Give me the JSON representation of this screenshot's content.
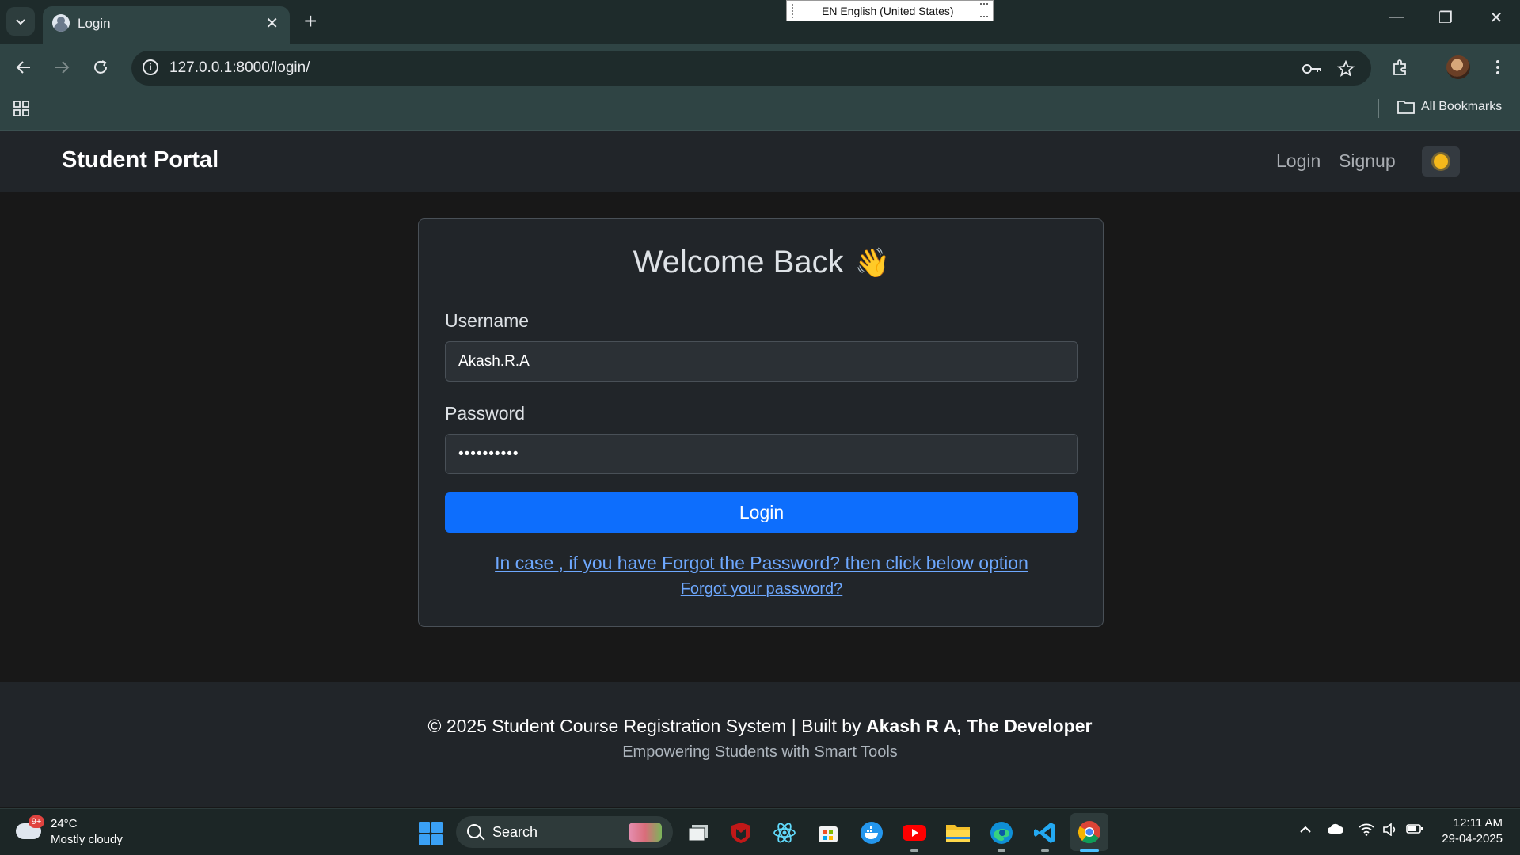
{
  "browser": {
    "tab_title": "Login",
    "url": "127.0.0.1:8000/login/",
    "language_indicator": "EN English (United States)",
    "all_bookmarks_label": "All Bookmarks"
  },
  "navbar": {
    "brand": "Student Portal",
    "links": [
      "Login",
      "Signup"
    ],
    "theme_toggle_icon": "sun-icon"
  },
  "login_card": {
    "title": "Welcome Back",
    "title_emoji": "👋",
    "username_label": "Username",
    "username_value": "Akash.R.A",
    "password_label": "Password",
    "password_value": "••••••••••",
    "login_button": "Login",
    "forgot_hint_link": "In case , if you have Forgot the Password? then click below option",
    "forgot_link": "Forgot your password?"
  },
  "footer": {
    "copyright": "© 2025 Student Course Registration System | Built by ",
    "author": "Akash R A, The Developer",
    "tagline": "Empowering Students with Smart Tools"
  },
  "taskbar": {
    "weather_temp": "24°C",
    "weather_desc": "Mostly cloudy",
    "weather_badge": "9+",
    "search_label": "Search",
    "clock_time": "12:11 AM",
    "clock_date": "29-04-2025"
  },
  "colors": {
    "primary": "#0d6efd",
    "link": "#6ea8fe",
    "card_bg": "#212529",
    "page_bg": "#181818"
  }
}
